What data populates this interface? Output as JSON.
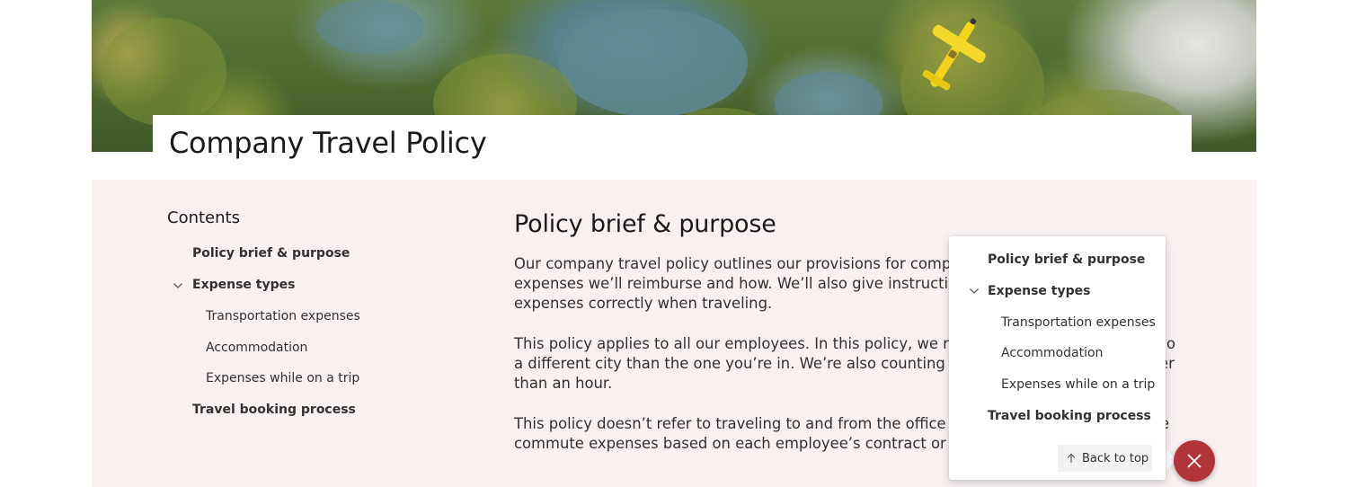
{
  "page": {
    "title": "Company Travel Policy"
  },
  "toc": {
    "heading": "Contents",
    "items": [
      {
        "label": "Policy brief & purpose",
        "level": 1,
        "expandable": false
      },
      {
        "label": "Expense types",
        "level": 1,
        "expandable": true,
        "expanded": true
      },
      {
        "label": "Transportation expenses",
        "level": 2
      },
      {
        "label": "Accommodation",
        "level": 2
      },
      {
        "label": "Expenses while on a trip",
        "level": 2
      },
      {
        "label": "Travel booking process",
        "level": 1,
        "expandable": false
      }
    ]
  },
  "article": {
    "heading": "Policy brief & purpose",
    "paragraphs": [
      {
        "lines": [
          "Our company travel policy outlines our provisions for company-re",
          "expenses we’ll reimburse and how. We’ll also give instructions to e",
          "expenses correctly when traveling."
        ]
      },
      {
        "lines": [
          "This policy applies to all our employees. In this policy, we refer to",
          "a different city than the one you’re in. We’re also counting any car",
          "than an hour."
        ],
        "tail": [
          "o",
          "er"
        ]
      },
      {
        "lines": [
          "This policy doesn’t refer to traveling to and from the office on a d",
          "commute expenses based on each employee’s contract or agreem"
        ],
        "tail": [
          "e"
        ]
      }
    ]
  },
  "popup": {
    "items": [
      {
        "label": "Policy brief & purpose",
        "level": 1
      },
      {
        "label": "Expense types",
        "level": 1,
        "expandable": true,
        "expanded": true
      },
      {
        "label": "Transportation expenses",
        "level": 2
      },
      {
        "label": "Accommodation",
        "level": 2
      },
      {
        "label": "Expenses while on a trip",
        "level": 2
      },
      {
        "label": "Travel booking process",
        "level": 1
      }
    ],
    "back_to_top": "Back to top"
  },
  "icons": {
    "chevron": "chevron-down-icon",
    "arrow_up": "arrow-up-icon",
    "close": "close-icon"
  },
  "colors": {
    "section_bg": "#f8f1f0",
    "fab": "#b1343a",
    "plane": "#f2d21a"
  }
}
